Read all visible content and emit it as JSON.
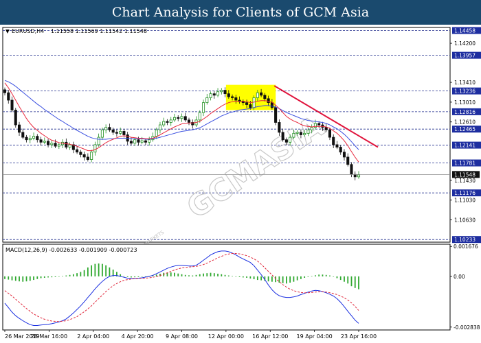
{
  "banner": {
    "title": "Chart Analysis for Clients of GCM Asia"
  },
  "watermark": {
    "brand": "GCMASIA",
    "tagline": "GLOBAL CAPITAL MARKETS"
  },
  "colors": {
    "banner_bg": "#1a4a6e",
    "bull_candle": "#1f8f1f",
    "bear_candle": "#111111",
    "ma_fast": "#e8283c",
    "ma_slow": "#3a4fe0",
    "level_line": "#1e2a8c",
    "trend_line": "#e0143c",
    "consolidation_box": "#ffff00",
    "last_price_box": "#111111",
    "level_label_bg": "#1e2ea0",
    "macd_histogram": "#2fa82f",
    "macd_line": "#1a2fe0",
    "signal_line": "#e0283c"
  },
  "chart_data": [
    {
      "type": "candlestick",
      "symbol_label": "EURUSD,H4",
      "ohlc_label": "1.11558 1.11569 1.11542 1.11548",
      "last_price": 1.11548,
      "ylim": [
        1.1018,
        1.1452
      ],
      "y_tick_labels": [
        "1.14200",
        "1.13410",
        "1.13010",
        "1.12610",
        "1.11430",
        "1.11030",
        "1.10630"
      ],
      "horizontal_levels": [
        1.14458,
        1.13957,
        1.13236,
        1.12816,
        1.12465,
        1.12141,
        1.11781,
        1.11176,
        1.10233
      ],
      "level_labels": [
        "1.14458",
        "1.13957",
        "1.13236",
        "1.12816",
        "1.12465",
        "1.12141",
        "1.11781",
        "1.11176",
        "1.10233"
      ],
      "x_labels": [
        "26 Mar 2019",
        "28 Mar 16:00",
        "2 Apr 04:00",
        "4 Apr 20:00",
        "9 Apr 08:00",
        "12 Apr 00:00",
        "16 Apr 12:00",
        "19 Apr 04:00",
        "23 Apr 16:00"
      ],
      "close_prices": [
        1.132,
        1.1305,
        1.1285,
        1.1255,
        1.124,
        1.123,
        1.1225,
        1.1228,
        1.1232,
        1.1225,
        1.122,
        1.1222,
        1.1215,
        1.1218,
        1.1212,
        1.1215,
        1.122,
        1.121,
        1.1215,
        1.1205,
        1.12,
        1.1195,
        1.119,
        1.1185,
        1.12,
        1.1215,
        1.123,
        1.1245,
        1.125,
        1.1245,
        1.124,
        1.1238,
        1.1242,
        1.1235,
        1.1222,
        1.1218,
        1.1225,
        1.122,
        1.1223,
        1.122,
        1.1225,
        1.1232,
        1.1245,
        1.1255,
        1.1262,
        1.126,
        1.1265,
        1.127,
        1.1268,
        1.1272,
        1.1265,
        1.126,
        1.1255,
        1.1265,
        1.128,
        1.13,
        1.131,
        1.1318,
        1.1315,
        1.1322,
        1.1325,
        1.1318,
        1.1312,
        1.131,
        1.1305,
        1.1302,
        1.13,
        1.1296,
        1.129,
        1.131,
        1.132,
        1.1315,
        1.1308,
        1.13,
        1.129,
        1.126,
        1.124,
        1.1225,
        1.122,
        1.123,
        1.1238,
        1.124,
        1.1235,
        1.1238,
        1.1245,
        1.125,
        1.1258,
        1.1255,
        1.125,
        1.1245,
        1.123,
        1.1215,
        1.121,
        1.12,
        1.119,
        1.1175,
        1.1155,
        1.115,
        1.1154
      ],
      "ma_fast": [
        1.134,
        1.133,
        1.1318,
        1.1305,
        1.1292,
        1.128,
        1.1268,
        1.1258,
        1.125,
        1.1244,
        1.1238,
        1.1233,
        1.1228,
        1.1224,
        1.1222,
        1.1219,
        1.1218,
        1.1217,
        1.1216,
        1.1214,
        1.1212,
        1.1209,
        1.1206,
        1.1203,
        1.1203,
        1.1205,
        1.1209,
        1.1214,
        1.1219,
        1.1223,
        1.1226,
        1.1229,
        1.1232,
        1.1233,
        1.1232,
        1.123,
        1.1229,
        1.1228,
        1.1228,
        1.1227,
        1.1227,
        1.1228,
        1.1231,
        1.1235,
        1.1239,
        1.1243,
        1.1247,
        1.1251,
        1.1254,
        1.1257,
        1.1258,
        1.1259,
        1.1259,
        1.126,
        1.1262,
        1.1267,
        1.1272,
        1.1278,
        1.1283,
        1.1288,
        1.1293,
        1.1297,
        1.13,
        1.1302,
        1.1303,
        1.1303,
        1.1303,
        1.1302,
        1.13,
        1.1301,
        1.1303,
        1.1304,
        1.1304,
        1.1303,
        1.1301,
        1.1295,
        1.1288,
        1.128,
        1.1272,
        1.1267,
        1.1263,
        1.126,
        1.1256,
        1.1253,
        1.1252,
        1.1251,
        1.1252,
        1.1252,
        1.1252,
        1.1251,
        1.1248,
        1.1243,
        1.1238,
        1.1231,
        1.1223,
        1.1213,
        1.1201,
        1.119,
        1.118
      ],
      "ma_slow": [
        1.1345,
        1.1342,
        1.1338,
        1.1333,
        1.1327,
        1.1321,
        1.1315,
        1.1309,
        1.1303,
        1.1297,
        1.1292,
        1.1286,
        1.1281,
        1.1276,
        1.1271,
        1.1266,
        1.1262,
        1.1257,
        1.1253,
        1.1248,
        1.1244,
        1.124,
        1.1236,
        1.1232,
        1.1229,
        1.1227,
        1.1226,
        1.1226,
        1.1226,
        1.1227,
        1.1227,
        1.1228,
        1.1228,
        1.1228,
        1.1228,
        1.1227,
        1.1227,
        1.1227,
        1.1227,
        1.1226,
        1.1226,
        1.1227,
        1.1228,
        1.123,
        1.1232,
        1.1234,
        1.1236,
        1.1238,
        1.124,
        1.1242,
        1.1243,
        1.1244,
        1.1245,
        1.1247,
        1.1249,
        1.1253,
        1.1257,
        1.1261,
        1.1265,
        1.1269,
        1.1273,
        1.1276,
        1.1279,
        1.1281,
        1.1283,
        1.1285,
        1.1286,
        1.1287,
        1.1288,
        1.129,
        1.1292,
        1.1293,
        1.1294,
        1.1294,
        1.1293,
        1.1291,
        1.1288,
        1.1284,
        1.128,
        1.1277,
        1.1274,
        1.1271,
        1.1268,
        1.1266,
        1.1264,
        1.1263,
        1.1262,
        1.1261,
        1.126,
        1.1258,
        1.1255,
        1.1251,
        1.1247,
        1.1242,
        1.1236,
        1.1229,
        1.1221,
        1.1213,
        1.1205
      ],
      "annotations": {
        "consolidation_box": {
          "x_from": "12 Apr 00:00",
          "x_to": "16 Apr 12:00",
          "y_range": [
            1.1285,
            1.1336
          ]
        },
        "downtrend_line": {
          "from": [
            "16 Apr 12:00",
            1.1334
          ],
          "to": [
            "23 Apr 16:00",
            1.121
          ]
        }
      }
    },
    {
      "type": "macd",
      "label": "MACD(12,26,9) -0.002633 -0.001909 -0.000723",
      "ylim": [
        -0.003,
        0.0018
      ],
      "y_tick_labels": [
        "0.001676",
        "0.00",
        "-0.002838"
      ],
      "histogram": [
        -0.00015,
        -0.00018,
        -0.00022,
        -0.00025,
        -0.00028,
        -0.0003,
        -0.00028,
        -0.00025,
        -0.0002,
        -0.00015,
        -0.0001,
        -8e-05,
        -6e-05,
        -5e-05,
        -4e-05,
        -2e-05,
        2e-05,
        5e-05,
        8e-05,
        0.00012,
        0.00018,
        0.00025,
        0.00035,
        0.0005,
        0.00062,
        0.0007,
        0.00072,
        0.0007,
        0.00062,
        0.0005,
        0.00038,
        0.00025,
        0.00012,
        2e-05,
        -4e-05,
        -6e-05,
        -5e-05,
        -4e-05,
        -2e-05,
        0.0,
        3e-05,
        6e-05,
        0.0001,
        0.00015,
        0.0002,
        0.00022,
        0.00022,
        0.0002,
        0.00016,
        0.00012,
        8e-05,
        6e-05,
        5e-05,
        8e-05,
        0.00012,
        0.00016,
        0.00018,
        0.0002,
        0.00018,
        0.00015,
        0.00012,
        8e-05,
        5e-05,
        2e-05,
        -2e-05,
        -4e-05,
        -6e-05,
        -8e-05,
        -0.00012,
        -0.00016,
        -0.0002,
        -0.00022,
        -0.00025,
        -0.00028,
        -0.0003,
        -0.00032,
        -0.00035,
        -0.00038,
        -0.0004,
        -0.00035,
        -0.0003,
        -0.00022,
        -0.00015,
        -8e-05,
        -3e-05,
        2e-05,
        6e-05,
        0.0001,
        0.0001,
        8e-05,
        5e-05,
        -2e-05,
        -0.0001,
        -0.0002,
        -0.0003,
        -0.0004,
        -0.00055,
        -0.00065,
        -0.00072
      ],
      "macd": [
        -0.0015,
        -0.00175,
        -0.002,
        -0.0022,
        -0.00235,
        -0.00248,
        -0.0026,
        -0.0027,
        -0.00275,
        -0.00275,
        -0.00272,
        -0.0027,
        -0.00268,
        -0.00265,
        -0.0026,
        -0.00255,
        -0.00248,
        -0.00238,
        -0.00222,
        -0.00205,
        -0.00185,
        -0.00165,
        -0.00142,
        -0.00118,
        -0.00095,
        -0.0007,
        -0.00048,
        -0.00028,
        -0.00012,
        0.0,
        5e-05,
        5e-05,
        0.0,
        -5e-05,
        -0.0001,
        -0.00012,
        -0.00012,
        -0.0001,
        -8e-05,
        -4e-05,
        0.0,
        6e-05,
        0.00015,
        0.00025,
        0.00035,
        0.00045,
        0.00052,
        0.00058,
        0.00062,
        0.00062,
        0.0006,
        0.00058,
        0.00058,
        0.00062,
        0.00075,
        0.0009,
        0.00105,
        0.0012,
        0.0013,
        0.00138,
        0.00142,
        0.00142,
        0.00138,
        0.0013,
        0.0012,
        0.00108,
        0.00098,
        0.00088,
        0.00078,
        0.0006,
        0.00035,
        0.0001,
        -0.00018,
        -0.00048,
        -0.00075,
        -0.00095,
        -0.00108,
        -0.00115,
        -0.00118,
        -0.00118,
        -0.00115,
        -0.0011,
        -0.00102,
        -0.00095,
        -0.00088,
        -0.00082,
        -0.00078,
        -0.0008,
        -0.00085,
        -0.00092,
        -0.001,
        -0.0011,
        -0.00125,
        -0.00145,
        -0.0017,
        -0.00195,
        -0.0022,
        -0.00245,
        -0.00263
      ],
      "signal": [
        -0.0008,
        -0.00095,
        -0.0011,
        -0.00128,
        -0.00145,
        -0.00162,
        -0.0018,
        -0.00195,
        -0.0021,
        -0.00222,
        -0.00232,
        -0.0024,
        -0.00246,
        -0.0025,
        -0.00252,
        -0.00253,
        -0.00251,
        -0.00248,
        -0.00242,
        -0.00234,
        -0.00225,
        -0.00212,
        -0.00198,
        -0.00182,
        -0.00165,
        -0.00145,
        -0.00125,
        -0.00105,
        -0.00085,
        -0.00068,
        -0.00052,
        -0.0004,
        -0.0003,
        -0.00022,
        -0.00018,
        -0.00015,
        -0.00013,
        -0.00012,
        -0.00011,
        -0.0001,
        -8e-05,
        -5e-05,
        -1e-05,
        5e-05,
        0.00012,
        0.0002,
        0.00028,
        0.00036,
        0.00042,
        0.00047,
        0.0005,
        0.00052,
        0.00054,
        0.00056,
        0.0006,
        0.00066,
        0.00074,
        0.00084,
        0.00094,
        0.00104,
        0.00112,
        0.0012,
        0.00125,
        0.00128,
        0.00128,
        0.00126,
        0.00122,
        0.00116,
        0.00108,
        0.00098,
        0.00085,
        0.00068,
        0.00048,
        0.00028,
        8e-05,
        -0.00012,
        -0.0003,
        -0.00046,
        -0.0006,
        -0.00072,
        -0.0008,
        -0.00086,
        -0.0009,
        -0.00092,
        -0.00092,
        -0.0009,
        -0.00088,
        -0.00086,
        -0.00086,
        -0.00088,
        -0.00092,
        -0.00096,
        -0.00102,
        -0.0011,
        -0.0012,
        -0.00132,
        -0.00148,
        -0.00168,
        -0.00191
      ]
    }
  ]
}
